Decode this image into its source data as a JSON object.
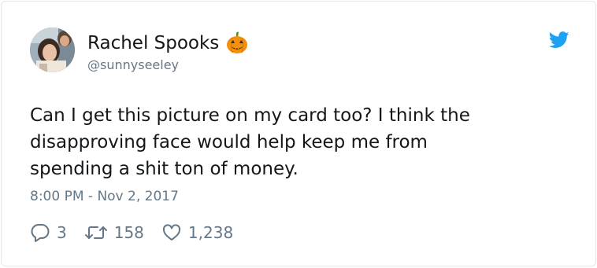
{
  "author": {
    "name": "Rachel Spooks",
    "name_emoji": "jack-o-lantern-icon",
    "handle": "@sunnyseeley",
    "avatar": "profile-photo"
  },
  "brand": {
    "logo": "twitter-bird-icon",
    "accent": "#1da1f2"
  },
  "tweet": {
    "lines": [
      "Can I get this picture on my card too? I think the",
      "disapproving face would help keep me from",
      "spending a shit ton of money."
    ],
    "timestamp": "8:00 PM - Nov 2, 2017"
  },
  "actions": {
    "replies": "3",
    "retweets": "158",
    "likes": "1,238",
    "reply_icon": "reply-icon",
    "retweet_icon": "retweet-icon",
    "like_icon": "heart-icon"
  },
  "colors": {
    "text": "#14171a",
    "secondary": "#657786",
    "border": "#e1e8ed",
    "pumpkin": "#f4900c"
  }
}
